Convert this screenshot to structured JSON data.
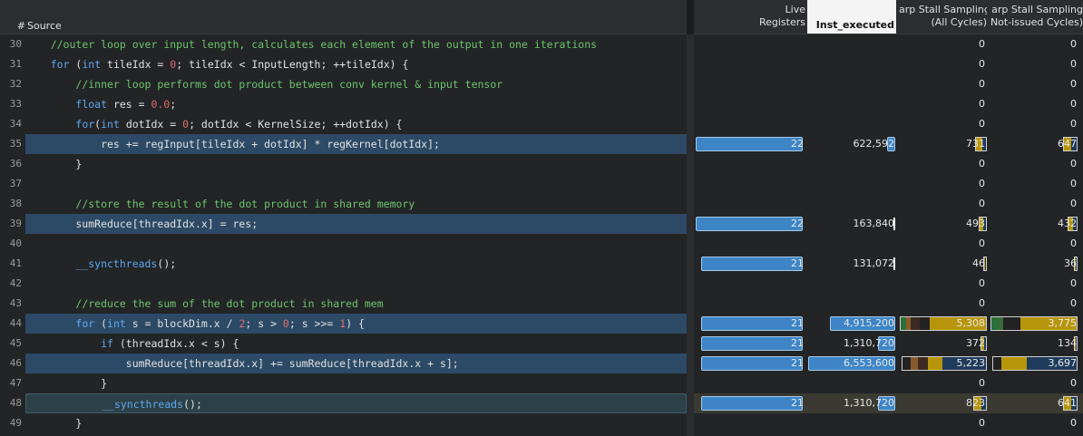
{
  "header": {
    "num_label": "#",
    "source_label": "Source",
    "live_registers": [
      "Live",
      "Registers"
    ],
    "inst_executed": "Inst_executed",
    "stall_all": [
      "arp Stall Sampling",
      "(All Cycles)"
    ],
    "stall_notissued": [
      "arp Stall Sampling",
      "Not-issued Cycles)"
    ]
  },
  "colors": {
    "comment": "#6ec56e",
    "keyword": "#5fa8f0",
    "number": "#e06c6c",
    "text": "#e2e2e2",
    "highlight_row": "#2c4a66",
    "current_row": "#2c4147",
    "bar": "#3d85c6"
  },
  "lines": [
    {
      "n": "30",
      "hl": "",
      "seg": [
        [
          "tx",
          "    "
        ],
        [
          "cm",
          "//outer loop over input length, calculates each element of the output in one iterations"
        ]
      ],
      "m": {
        "all": "0",
        "nis": "0"
      }
    },
    {
      "n": "31",
      "hl": "",
      "seg": [
        [
          "tx",
          "    "
        ],
        [
          "kw",
          "for"
        ],
        [
          "tx",
          " ("
        ],
        [
          "kw",
          "int"
        ],
        [
          "tx",
          " tileIdx = "
        ],
        [
          "num",
          "0"
        ],
        [
          "tx",
          "; tileIdx < InputLength; ++tileIdx) {"
        ]
      ],
      "m": {
        "all": "0",
        "nis": "0"
      }
    },
    {
      "n": "32",
      "hl": "",
      "seg": [
        [
          "tx",
          "        "
        ],
        [
          "cm",
          "//inner loop performs dot product between conv kernel & input tensor"
        ]
      ],
      "m": {
        "all": "0",
        "nis": "0"
      }
    },
    {
      "n": "33",
      "hl": "",
      "seg": [
        [
          "tx",
          "        "
        ],
        [
          "kw",
          "float"
        ],
        [
          "tx",
          " res = "
        ],
        [
          "num",
          "0.0"
        ],
        [
          "tx",
          ";"
        ]
      ],
      "m": {
        "all": "0",
        "nis": "0"
      }
    },
    {
      "n": "34",
      "hl": "",
      "seg": [
        [
          "tx",
          "        "
        ],
        [
          "kw",
          "for"
        ],
        [
          "tx",
          "("
        ],
        [
          "kw",
          "int"
        ],
        [
          "tx",
          " dotIdx = "
        ],
        [
          "num",
          "0"
        ],
        [
          "tx",
          "; dotIdx < KernelSize; ++dotIdx) {"
        ]
      ],
      "m": {
        "all": "0",
        "nis": "0"
      }
    },
    {
      "n": "35",
      "hl": "sel",
      "seg": [
        [
          "tx",
          "            res += regInput[tileIdx + dotIdx] * regKernel[dotIdx];"
        ]
      ],
      "m": {
        "reg": "22",
        "reg_frac": 1.0,
        "inst": "622,592",
        "inst_frac": 0.095,
        "all": "731",
        "all_frac": 0.138,
        "nis": "647",
        "nis_frac": 0.171
      }
    },
    {
      "n": "36",
      "hl": "",
      "seg": [
        [
          "tx",
          "        }"
        ]
      ],
      "m": {
        "all": "0",
        "nis": "0"
      }
    },
    {
      "n": "37",
      "hl": "",
      "seg": [
        [
          "tx",
          ""
        ]
      ],
      "m": {
        "all": "0",
        "nis": "0"
      }
    },
    {
      "n": "38",
      "hl": "",
      "seg": [
        [
          "tx",
          "        "
        ],
        [
          "cm",
          "//store the result of the dot product in shared memory"
        ]
      ],
      "m": {
        "all": "0",
        "nis": "0"
      }
    },
    {
      "n": "39",
      "hl": "sel",
      "seg": [
        [
          "tx",
          "        sumReduce[threadIdx.x] = res;"
        ]
      ],
      "m": {
        "reg": "22",
        "reg_frac": 1.0,
        "inst": "163,840",
        "inst_frac": 0.025,
        "all": "493",
        "all_frac": 0.093,
        "nis": "432",
        "nis_frac": 0.114
      }
    },
    {
      "n": "40",
      "hl": "",
      "seg": [
        [
          "tx",
          ""
        ]
      ],
      "m": {
        "all": "0",
        "nis": "0"
      }
    },
    {
      "n": "41",
      "hl": "",
      "seg": [
        [
          "tx",
          "        "
        ],
        [
          "fn",
          "__syncthreads"
        ],
        [
          "tx",
          "();"
        ]
      ],
      "m": {
        "reg": "21",
        "reg_frac": 0.95,
        "inst": "131,072",
        "inst_frac": 0.02,
        "all": "46",
        "all_frac": 0.01,
        "nis": "36",
        "nis_frac": 0.01
      }
    },
    {
      "n": "42",
      "hl": "",
      "seg": [
        [
          "tx",
          ""
        ]
      ],
      "m": {
        "all": "0",
        "nis": "0"
      }
    },
    {
      "n": "43",
      "hl": "",
      "seg": [
        [
          "tx",
          "        "
        ],
        [
          "cm",
          "//reduce the sum of the dot product in shared mem"
        ]
      ],
      "m": {
        "all": "0",
        "nis": "0"
      }
    },
    {
      "n": "44",
      "hl": "sel",
      "seg": [
        [
          "tx",
          "        "
        ],
        [
          "kw",
          "for"
        ],
        [
          "tx",
          " ("
        ],
        [
          "kw",
          "int"
        ],
        [
          "tx",
          " s = blockDim.x / "
        ],
        [
          "num",
          "2"
        ],
        [
          "tx",
          "; s > "
        ],
        [
          "num",
          "0"
        ],
        [
          "tx",
          "; s >>= "
        ],
        [
          "num",
          "1"
        ],
        [
          "tx",
          ") {"
        ]
      ],
      "m": {
        "reg": "21",
        "reg_frac": 0.95,
        "inst": "4,915,200",
        "inst_frac": 0.75,
        "all": "5,308",
        "all_frac": 1.0,
        "nis": "3,775",
        "nis_frac": 1.0
      }
    },
    {
      "n": "45",
      "hl": "",
      "seg": [
        [
          "tx",
          "            "
        ],
        [
          "kw",
          "if"
        ],
        [
          "tx",
          " (threadIdx.x < s) {"
        ]
      ],
      "m": {
        "reg": "21",
        "reg_frac": 0.95,
        "inst": "1,310,720",
        "inst_frac": 0.2,
        "all": "372",
        "all_frac": 0.07,
        "nis": "134",
        "nis_frac": 0.035
      }
    },
    {
      "n": "46",
      "hl": "sel",
      "seg": [
        [
          "tx",
          "                sumReduce[threadIdx.x] += sumReduce[threadIdx.x + s];"
        ]
      ],
      "m": {
        "reg": "21",
        "reg_frac": 0.95,
        "inst": "6,553,600",
        "inst_frac": 1.0,
        "all": "5,223",
        "all_frac": 0.984,
        "nis": "3,697",
        "nis_frac": 0.98
      }
    },
    {
      "n": "47",
      "hl": "",
      "seg": [
        [
          "tx",
          "            }"
        ]
      ],
      "m": {
        "all": "0",
        "nis": "0"
      }
    },
    {
      "n": "48",
      "hl": "cur",
      "seg": [
        [
          "tx",
          "            "
        ],
        [
          "fn",
          "__syncthreads"
        ],
        [
          "tx",
          "();"
        ]
      ],
      "m": {
        "reg": "21",
        "reg_frac": 0.95,
        "inst": "1,310,720",
        "inst_frac": 0.2,
        "all": "823",
        "all_frac": 0.155,
        "nis": "641",
        "nis_frac": 0.17
      }
    },
    {
      "n": "49",
      "hl": "",
      "seg": [
        [
          "tx",
          "        }"
        ]
      ],
      "m": {
        "all": "0",
        "nis": "0"
      }
    }
  ]
}
